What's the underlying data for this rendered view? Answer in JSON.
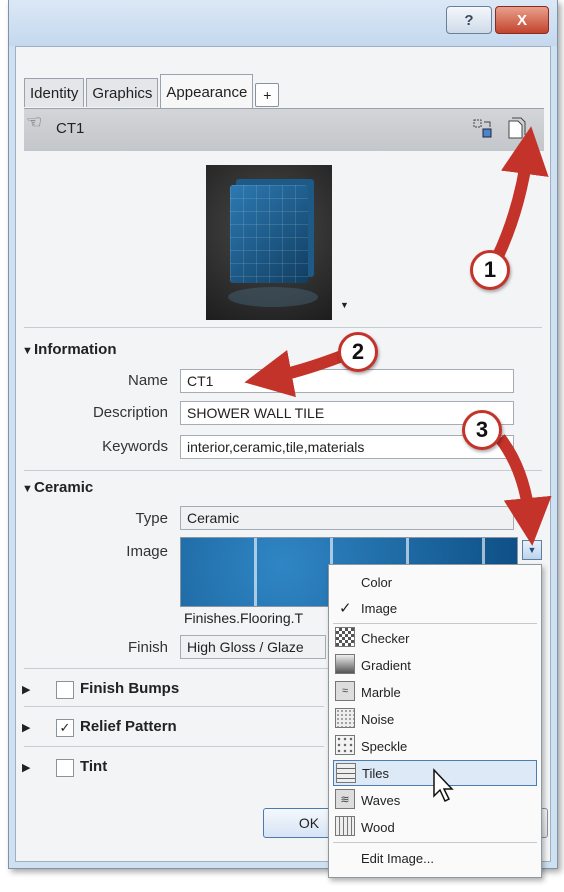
{
  "titlebar": {
    "help_icon": "?",
    "close_icon": "X"
  },
  "tabs": [
    {
      "label": "Identity"
    },
    {
      "label": "Graphics"
    },
    {
      "label": "Appearance"
    }
  ],
  "add_tab": "+",
  "asset": {
    "name": "CT1"
  },
  "information": {
    "heading": "Information",
    "name_label": "Name",
    "name_value": "CT1",
    "description_label": "Description",
    "description_value": "SHOWER WALL TILE",
    "keywords_label": "Keywords",
    "keywords_value": "interior,ceramic,tile,materials"
  },
  "ceramic": {
    "heading": "Ceramic",
    "type_label": "Type",
    "type_value": "Ceramic",
    "image_label": "Image",
    "image_file": "Finishes.Flooring.T",
    "finish_label": "Finish",
    "finish_value": "High Gloss / Glaze"
  },
  "sections": {
    "finish_bumps": "Finish Bumps",
    "relief_pattern": "Relief Pattern",
    "tint": "Tint"
  },
  "menu": {
    "items": [
      {
        "label": "Color"
      },
      {
        "label": "Image",
        "checked": true
      },
      {
        "label": "Checker"
      },
      {
        "label": "Gradient"
      },
      {
        "label": "Marble"
      },
      {
        "label": "Noise"
      },
      {
        "label": "Speckle"
      },
      {
        "label": "Tiles",
        "highlighted": true
      },
      {
        "label": "Waves"
      },
      {
        "label": "Wood"
      },
      {
        "label": "Edit Image..."
      }
    ]
  },
  "buttons": {
    "ok": "OK"
  },
  "callouts": [
    "1",
    "2",
    "3"
  ],
  "colors": {
    "callout_red": "#c4332a",
    "highlight": "#4c7cb5"
  }
}
